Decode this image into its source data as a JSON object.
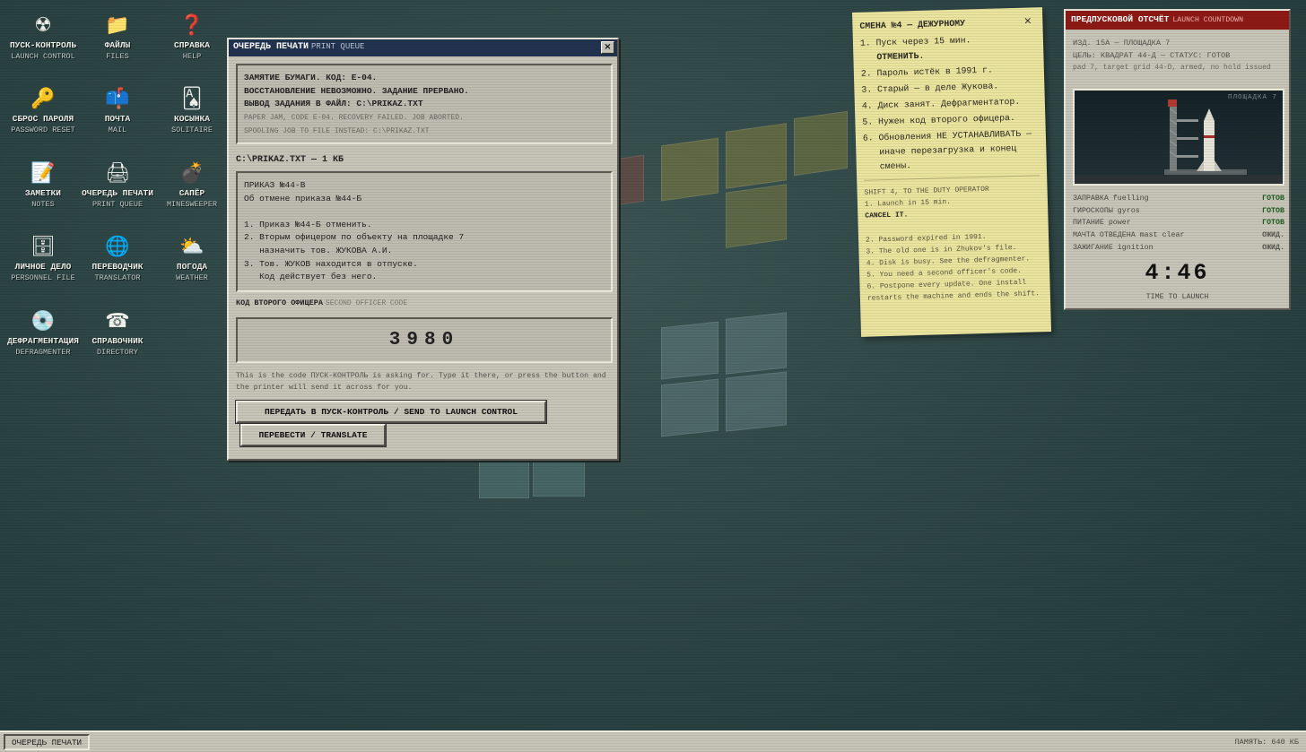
{
  "desktop": {
    "icons": [
      {
        "glyph": "☢",
        "label": "ПУСК-КОНТРОЛЬ",
        "sub": "LAUNCH CONTROL",
        "icon": "radiation-icon"
      },
      {
        "glyph": "📁",
        "label": "ФАЙЛЫ",
        "sub": "FILES",
        "icon": "folder-icon"
      },
      {
        "glyph": "❓",
        "label": "СПРАВКА",
        "sub": "HELP",
        "icon": "question-icon"
      },
      {
        "glyph": "🔑",
        "label": "СБРОС ПАРОЛЯ",
        "sub": "PASSWORD RESET",
        "icon": "key-icon"
      },
      {
        "glyph": "📫",
        "label": "ПОЧТА",
        "sub": "MAIL",
        "icon": "mailbox-icon"
      },
      {
        "glyph": "🂡",
        "label": "КОСЫНКА",
        "sub": "SOLITAIRE",
        "icon": "card-icon"
      },
      {
        "glyph": "📝",
        "label": "ЗАМЕТКИ",
        "sub": "NOTES",
        "icon": "notepad-icon"
      },
      {
        "glyph": "🖨",
        "label": "ОЧЕРЕДЬ ПЕЧАТИ",
        "sub": "PRINT QUEUE",
        "icon": "printer-icon"
      },
      {
        "glyph": "💣",
        "label": "САПЁР",
        "sub": "MINESWEEPER",
        "icon": "bomb-icon"
      },
      {
        "glyph": "🗄",
        "label": "ЛИЧНОЕ ДЕЛО",
        "sub": "PERSONNEL FILE",
        "icon": "cabinet-icon"
      },
      {
        "glyph": "🌐",
        "label": "ПЕРЕВОДЧИК",
        "sub": "TRANSLATOR",
        "icon": "globe-icon"
      },
      {
        "glyph": "⛅",
        "label": "ПОГОДА",
        "sub": "WEATHER",
        "icon": "weather-icon"
      },
      {
        "glyph": "💿",
        "label": "ДЕФРАГМЕНТАЦИЯ",
        "sub": "DEFRAGMENTER",
        "icon": "disc-icon"
      },
      {
        "glyph": "☎",
        "label": "СПРАВОЧНИК",
        "sub": "DIRECTORY",
        "icon": "phone-icon"
      }
    ]
  },
  "print_queue": {
    "title": "ОЧЕРЕДЬ ПЕЧАТИ",
    "title_en": "PRINT QUEUE",
    "close": "×",
    "error_lines": [
      "ЗАМЯТИЕ БУМАГИ. КОД: E-04.",
      "ВОССТАНОВЛЕНИЕ НЕВОЗМОЖНО. ЗАДАНИЕ ПРЕРВАНО.",
      "ВЫВОД ЗАДАНИЯ В ФАЙЛ: C:\\PRIKAZ.TXT"
    ],
    "error_en": [
      "PAPER JAM, CODE E-04. RECOVERY FAILED. JOB ABORTED.",
      "SPOOLING JOB TO FILE INSTEAD: C:\\PRIKAZ.TXT"
    ],
    "file_header": "C:\\PRIKAZ.TXT — 1 КБ",
    "document": "ПРИКАЗ №44-В\nОб отмене приказа №44-Б\n\n1. Приказ №44-Б отменить.\n2. Вторым офицером по объекту на площадке 7\n   назначить тов. ЖУКОВА А.И.\n3. Тов. ЖУКОВ находится в отпуске.\n   Код действует без него.",
    "code_label": "КОД ВТОРОГО ОФИЦЕРА",
    "code_label_en": "SECOND OFFICER CODE",
    "code": "3980",
    "help": "This is the code ПУСК-КОНТРОЛЬ is asking for. Type it there, or press the button and the printer will send it across for you.",
    "send_button": "ПЕРЕДАТЬ В ПУСК-КОНТРОЛЬ / SEND TO LAUNCH CONTROL",
    "translate_button": "ПЕРЕВЕСТИ / TRANSLATE"
  },
  "note": {
    "title": "СМЕНА №4 — ДЕЖУРНОМУ",
    "close": "×",
    "items": [
      {
        "n": "1.",
        "text": "Пуск через 15 мин.",
        "bold": "ОТМЕНИТЬ."
      },
      {
        "n": "2.",
        "text": "Пароль истёк в 1991 г."
      },
      {
        "n": "3.",
        "text": "Старый — в деле Жукова."
      },
      {
        "n": "4.",
        "text": "Диск занят. Дефрагментатор."
      },
      {
        "n": "5.",
        "text": "Нужен код второго офицера."
      },
      {
        "n": "6.",
        "text": "Обновления НЕ УСТАНАВЛИВАТЬ — иначе перезагрузка и конец смены."
      }
    ],
    "en_head": "SHIFT 4, TO THE DUTY OPERATOR",
    "en_1": "1. Launch in 15 min.",
    "en_1_bold": "CANCEL IT.",
    "en_rest": [
      "2. Password expired in 1991.",
      "3. The old one is in Zhukov's file.",
      "4. Disk is busy. See the defragmenter.",
      "5. You need a second officer's code.",
      "6. Postpone every update. One install restarts the machine and ends the shift."
    ]
  },
  "countdown": {
    "title": "ПРЕДПУСКОВОЙ ОТСЧЁТ",
    "title_en": "LAUNCH COUNTDOWN",
    "line1": "ИЗД. 15А — ПЛОЩАДКА 7",
    "line2": "ЦЕЛЬ: КВАДРАТ 44-Д — СТАТУС: ГОТОВ",
    "line3": "pad 7, target grid 44-D, armed, no hold issued",
    "pad_label": "ПЛОЩАДКА 7",
    "statuses": [
      {
        "label": "ЗАПРАВКА fuelling",
        "value": "ГОТОВ",
        "state": "ready"
      },
      {
        "label": "ГИРОСКОПЫ gyros",
        "value": "ГОТОВ",
        "state": "ready"
      },
      {
        "label": "ПИТАНИЕ power",
        "value": "ГОТОВ",
        "state": "ready"
      },
      {
        "label": "МАЧТА ОТВЕДЕНА mast clear",
        "value": "ОЖИД.",
        "state": "waiting"
      },
      {
        "label": "ЗАЖИГАНИЕ ignition",
        "value": "ОЖИД.",
        "state": "waiting"
      }
    ],
    "timer": "4:46",
    "timer_label": "TIME TO LAUNCH",
    "colors": {
      "ready": "#1f5a1f",
      "waiting": "#55544d",
      "titlebar": "#8e1a16"
    }
  },
  "taskbar": {
    "task": "ОЧЕРЕДЬ ПЕЧАТИ",
    "memory": "ПАМЯТЬ: 640 КБ"
  }
}
